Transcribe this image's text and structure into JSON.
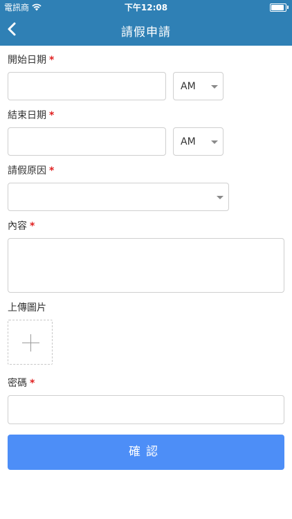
{
  "status_bar": {
    "carrier": "電訊商",
    "time": "下午12:08",
    "wifi_icon": "wifi-icon",
    "battery_icon": "battery-icon",
    "battery_level": 0.9
  },
  "nav": {
    "title": "請假申請",
    "back_icon": "chevron-left-icon"
  },
  "form": {
    "start_date": {
      "label": "開始日期",
      "required_mark": "*",
      "value": "",
      "period": "AM"
    },
    "end_date": {
      "label": "結束日期",
      "required_mark": "*",
      "value": "",
      "period": "AM"
    },
    "reason": {
      "label": "請假原因",
      "required_mark": "*",
      "value": ""
    },
    "content": {
      "label": "內容",
      "required_mark": "*",
      "value": ""
    },
    "upload": {
      "label": "上傳圖片",
      "icon": "plus-icon"
    },
    "password": {
      "label": "密碼",
      "required_mark": "*",
      "value": ""
    },
    "submit_label": "確認"
  },
  "colors": {
    "header_bg": "#2f80b5",
    "button_bg": "#4d8ef7",
    "required": "#e02020"
  }
}
